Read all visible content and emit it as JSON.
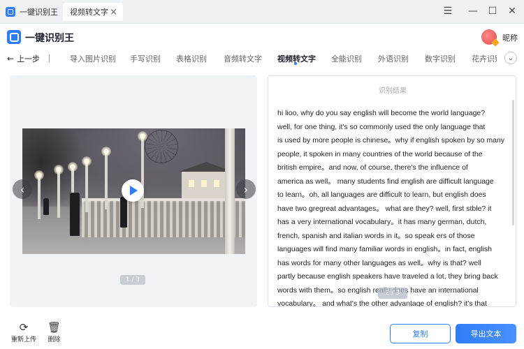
{
  "window": {
    "tabs": [
      {
        "label": "一键识别王"
      },
      {
        "label": "视频转文字"
      }
    ],
    "controls": {
      "menu": "☰",
      "minimize": "—",
      "maximize": "☐",
      "close": "✕"
    }
  },
  "header": {
    "brand": "一键识别王",
    "user_name": "昵称"
  },
  "nav": {
    "back_label": "上一步",
    "items": [
      {
        "label": "导入图片识别"
      },
      {
        "label": "手写识别"
      },
      {
        "label": "表格识别"
      },
      {
        "label": "音频转文字"
      },
      {
        "label": "视频转文字",
        "active": true
      },
      {
        "label": "全能识别"
      },
      {
        "label": "外语识别"
      },
      {
        "label": "数字识别"
      },
      {
        "label": "花卉识别"
      }
    ]
  },
  "preview": {
    "pager": "1 / 3"
  },
  "result": {
    "title": "识别结果",
    "lines": [
      "hi lioo,  why do you say english will become the world language?",
      "well,  for one thing,  it's so commonly used the only language that",
      "is used by more people is chinese。why if english spoken by so many",
      "people,  it spoken in many countries of the world because of the",
      "british empire。and now,  of course,  there's the influence of",
      "america as well。 many students find english are difficult language",
      "to learn。oh,  all languages are difficult to learn,  but english does",
      "have two gregreat advantages。 what are they?  well,  first stble?  it",
      "has a very international vocabulary。it has many german,  dutch,",
      "french,  spanish and italian words in it。so speak ers of those",
      "languages will find many familiar words in english。in fact,  english",
      "has words for many other languages as well。why is that?  well",
      "partly because english speakers have traveled a lot,  they bring back",
      "words with them。so english really does have an international",
      "vocabulary。 and what's the other advantage of english?  it's that"
    ],
    "pager": "2 / 3"
  },
  "footer": {
    "reupload_label": "重新上传",
    "delete_label": "删除",
    "copy_label": "复制",
    "export_label": "导出文本"
  },
  "colors": {
    "accent": "#2f7df6",
    "titlebar_bg": "#eef0f4",
    "preview_bg": "#f1f3f7"
  }
}
